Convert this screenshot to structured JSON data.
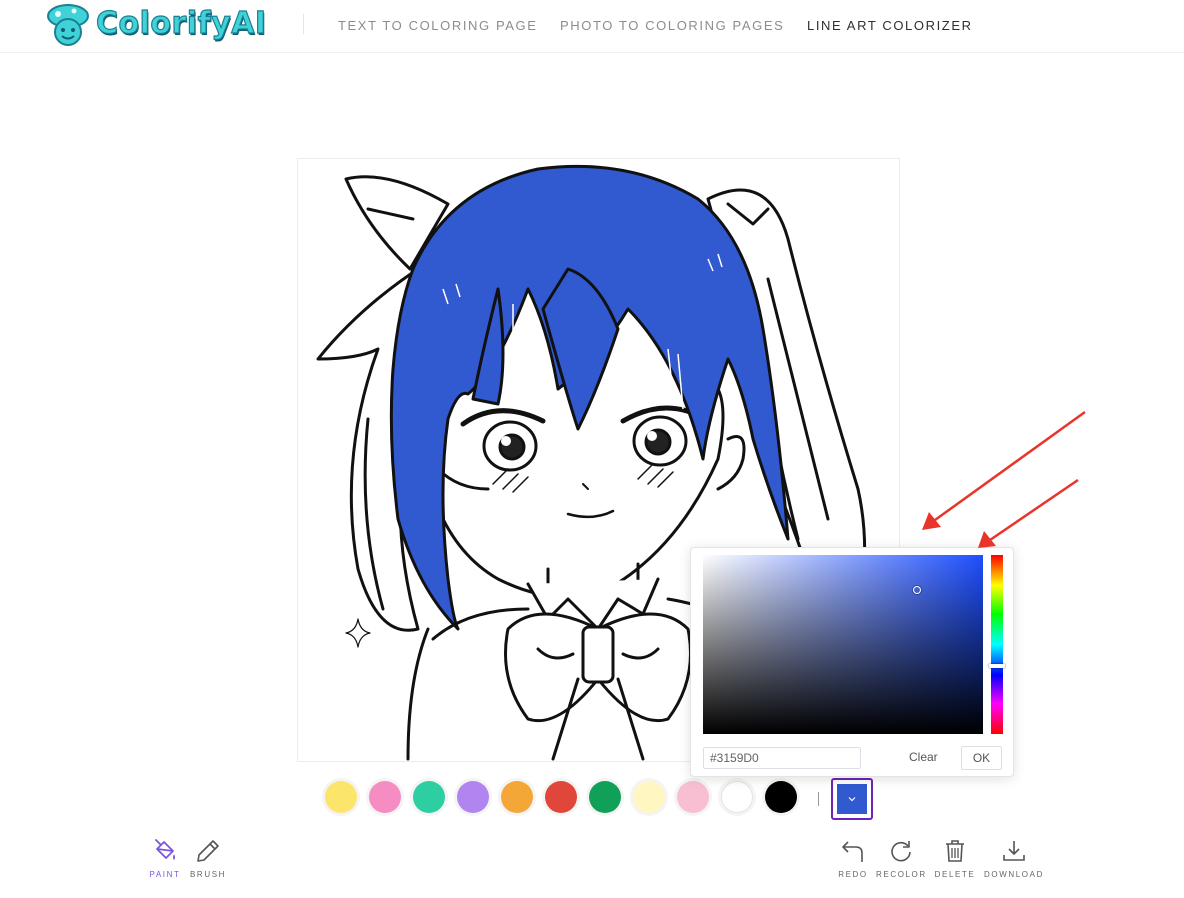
{
  "header": {
    "logo_text": "ColorifyAI",
    "nav": [
      {
        "label": "TEXT TO COLORING PAGE"
      },
      {
        "label": "PHOTO TO COLORING PAGES"
      },
      {
        "label": "LINE ART COLORIZER"
      }
    ]
  },
  "palette": {
    "colors": [
      "#FCE56B",
      "#F58DC3",
      "#2DCFA2",
      "#B085EF",
      "#F4A636",
      "#E0473A",
      "#11A058",
      "#FFF6C2",
      "#F8BFD3",
      "#FFFFFF",
      "#000000"
    ],
    "current_color": "#3159D0"
  },
  "picker": {
    "hex_value": "#3159D0",
    "clear_label": "Clear",
    "ok_label": "OK"
  },
  "tools_left": [
    {
      "label": "PAINT",
      "icon": "paint-bucket-icon",
      "active": true
    },
    {
      "label": "BRUSH",
      "icon": "brush-icon",
      "active": false
    }
  ],
  "tools_right": [
    {
      "label": "REDO",
      "icon": "undo-arrow-icon"
    },
    {
      "label": "RECOLOR",
      "icon": "refresh-icon"
    },
    {
      "label": "DELETE",
      "icon": "trash-icon"
    },
    {
      "label": "DOWNLOAD",
      "icon": "download-icon"
    }
  ],
  "colors": {
    "accent": "#7B55E0",
    "trigger_border": "#6E24B8",
    "hair_fill": "#3159D0",
    "arrow": "#E8342A"
  }
}
